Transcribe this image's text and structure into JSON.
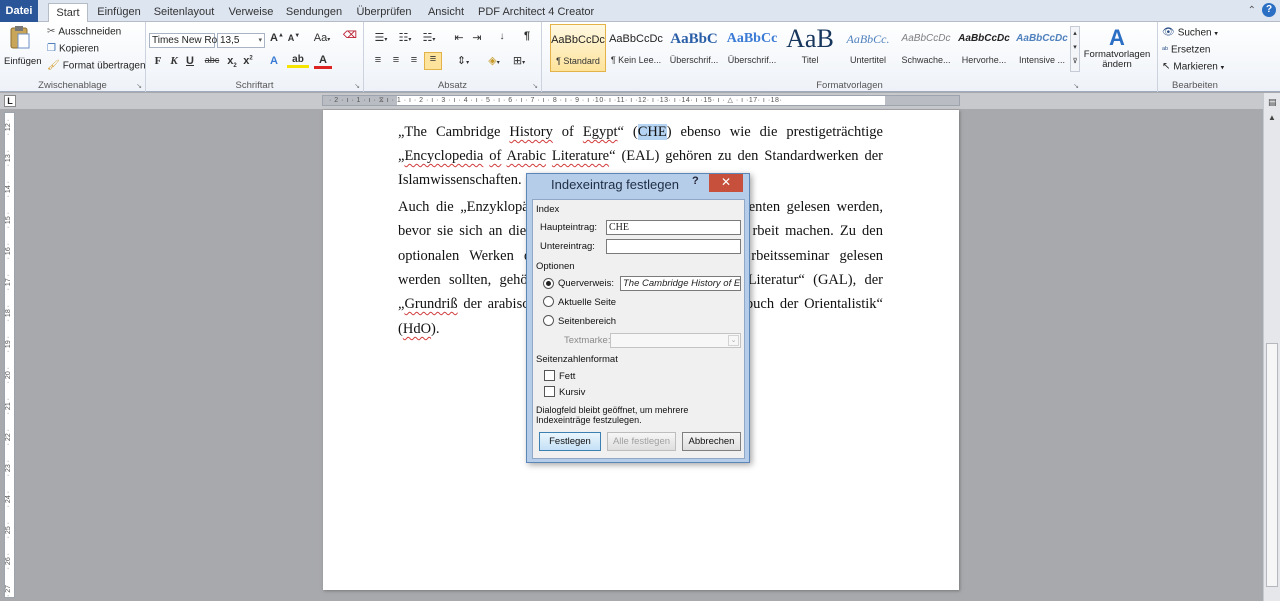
{
  "tabs": {
    "file": "Datei",
    "start": "Start",
    "insert": "Einfügen",
    "layout": "Seitenlayout",
    "references": "Verweise",
    "mailings": "Sendungen",
    "review": "Überprüfen",
    "view": "Ansicht",
    "pdf": "PDF Architect 4 Creator"
  },
  "clipboard": {
    "paste": "Einfügen",
    "cut": "Ausschneiden",
    "copy": "Kopieren",
    "format_painter": "Format übertragen",
    "label": "Zwischenablage"
  },
  "font": {
    "name": "Times New Ro",
    "size": "13,5",
    "label": "Schriftart"
  },
  "paragraph": {
    "label": "Absatz"
  },
  "styles": {
    "label": "Formatvorlagen",
    "change": "Formatvorlagen ändern",
    "items": [
      {
        "preview": "AaBbCcDc",
        "name": "¶ Standard"
      },
      {
        "preview": "AaBbCcDc",
        "name": "¶ Kein Lee..."
      },
      {
        "preview": "AaBbC",
        "name": "Überschrif..."
      },
      {
        "preview": "AaBbCc",
        "name": "Überschrif..."
      },
      {
        "preview": "AaB",
        "name": "Titel"
      },
      {
        "preview": "AaBbCc.",
        "name": "Untertitel"
      },
      {
        "preview": "AaBbCcDc",
        "name": "Schwache..."
      },
      {
        "preview": "AaBbCcDc",
        "name": "Hervorhe..."
      },
      {
        "preview": "AaBbCcDc",
        "name": "Intensive ..."
      }
    ]
  },
  "editing": {
    "find": "Suchen",
    "replace": "Ersetzen",
    "select": "Markieren",
    "label": "Bearbeiten"
  },
  "document": {
    "l1a": "„The Cambridge ",
    "l1b": "History",
    " l1c": "",
    "l1_of": " of ",
    "l1d": "Egypt",
    "l1e": "“ (",
    "l1f": "CHE",
    "l1g": ") ebenso wie die prestigeträchtige",
    "l2a": "„",
    "l2b": "Encyclopedia",
    "l2c": " ",
    "l2d": "of",
    "l2e": " ",
    "l2f": "Arabic",
    "l2g": " ",
    "l2h": "Literature",
    "l2i": "“ (EAL) gehören zu den Standardwerken der",
    "l3": "Islamwissenschaften.",
    "l4a": "Auch die „Enzyklopä",
    "l4b": "enten gelesen werden,",
    "l5a": "bevor sie sich an die V",
    "l5b": "rbeit machen. Zu den",
    "l6a": "optionalen Werken d",
    "l6b": "rbeitsseminar gelesen",
    "l7a": "werden sollten, gehö",
    "l7b": "Literatur“ (GAL), der",
    "l8a": "„",
    "l8b": "Grundriß",
    "l8c": " der arabisch",
    "l8d": "buch der Orientalistik“",
    "l9a": "(",
    "l9b": "HdO",
    "l9c": ")."
  },
  "dialog": {
    "title": "Indexeintrag festlegen",
    "help": "?",
    "close": "✕",
    "index_section": "Index",
    "main_entry_label": "Haupteintrag:",
    "main_entry_value": "CHE",
    "sub_entry_label": "Untereintrag:",
    "sub_entry_value": "",
    "options_section": "Optionen",
    "cross_ref_label": "Querverweis:",
    "cross_ref_value": "The Cambridge History of Eg",
    "current_page": "Aktuelle Seite",
    "page_range": "Seitenbereich",
    "bookmark_label": "Textmarke:",
    "page_format_section": "Seitenzahlenformat",
    "bold": "Fett",
    "italic": "Kursiv",
    "note": "Dialogfeld bleibt geöffnet, um mehrere Indexeinträge festzulegen.",
    "mark": "Festlegen",
    "mark_all": "Alle festlegen",
    "cancel": "Abbrechen"
  }
}
